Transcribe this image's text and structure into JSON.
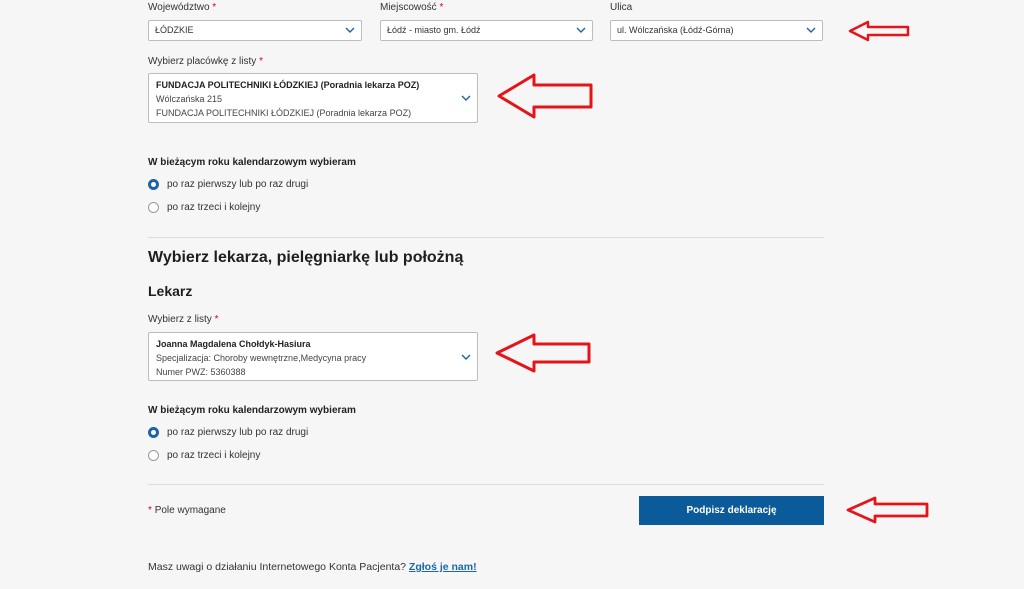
{
  "location": {
    "voivodeship_label": "Województwo",
    "voivodeship_value": "ŁÓDZKIE",
    "city_label": "Miejscowość",
    "city_value": "Łódź - miasto gm. Łódź",
    "street_label": "Ulica",
    "street_value": "ul. Wólczańska (Łódź-Górna)",
    "required_mark": "*"
  },
  "facility": {
    "label": "Wybierz placówkę z listy",
    "name": "FUNDACJA POLITECHNIKI ŁÓDZKIEJ (Poradnia lekarza POZ)",
    "address": "Wólczańska 215",
    "subname": "FUNDACJA POLITECHNIKI ŁÓDZKIEJ (Poradnia lekarza POZ)"
  },
  "choice1": {
    "title": "W bieżącym roku kalendarzowym wybieram",
    "opt1": "po raz pierwszy lub po raz drugi",
    "opt2": "po raz trzeci i kolejny",
    "selected": 1
  },
  "section": {
    "heading": "Wybierz lekarza, pielęgniarkę lub położną",
    "subheading": "Lekarz"
  },
  "doctor": {
    "label": "Wybierz z listy",
    "name": "Joanna Magdalena Chołdyk-Hasiura",
    "specialization": "Specjalizacja: Choroby wewnętrzne,Medycyna pracy",
    "pwz": "Numer PWZ: 5360388"
  },
  "choice2": {
    "title": "W bieżącym roku kalendarzowym wybieram",
    "opt1": "po raz pierwszy lub po raz drugi",
    "opt2": "po raz trzeci i kolejny",
    "selected": 1
  },
  "form": {
    "required_note_mark": "*",
    "required_note": "Pole wymagane",
    "submit_label": "Podpisz deklarację"
  },
  "footer": {
    "text": "Masz uwagi o działaniu Internetowego Konta Pacjenta?",
    "link": "Zgłoś je nam!"
  },
  "colors": {
    "accent": "#0b5a9a",
    "required": "#d0021b",
    "annotation_arrow": "#e3151a"
  }
}
